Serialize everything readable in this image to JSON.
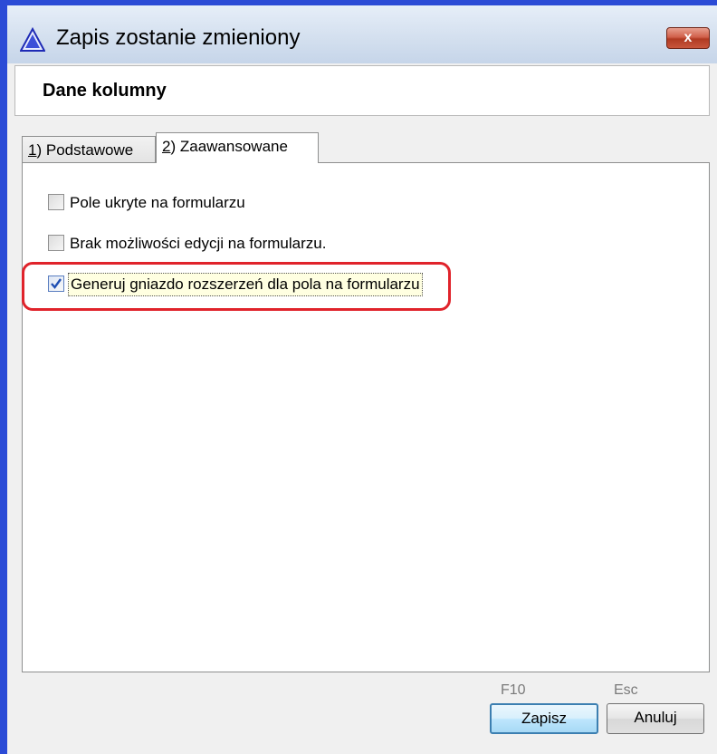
{
  "window": {
    "title": "Zapis zostanie zmieniony",
    "close_label": "x"
  },
  "header": {
    "title": "Dane kolumny"
  },
  "tabs": [
    {
      "key": "1",
      "label": ") Podstawowe",
      "active": false
    },
    {
      "key": "2",
      "label": ") Zaawansowane",
      "active": true
    }
  ],
  "options": [
    {
      "label": "Pole ukryte na formularzu",
      "checked": false
    },
    {
      "label": "Brak możliwości edycji na formularzu.",
      "checked": false
    },
    {
      "label": "Generuj gniazdo rozszerzeń dla pola na formularzu",
      "checked": true,
      "focused": true,
      "highlighted": true
    }
  ],
  "footer": {
    "save_hint": "F10",
    "save_label": "Zapisz",
    "cancel_hint": "Esc",
    "cancel_label": "Anuluj"
  },
  "colors": {
    "highlight": "#e0232b",
    "window_border": "#2b4bd6"
  }
}
